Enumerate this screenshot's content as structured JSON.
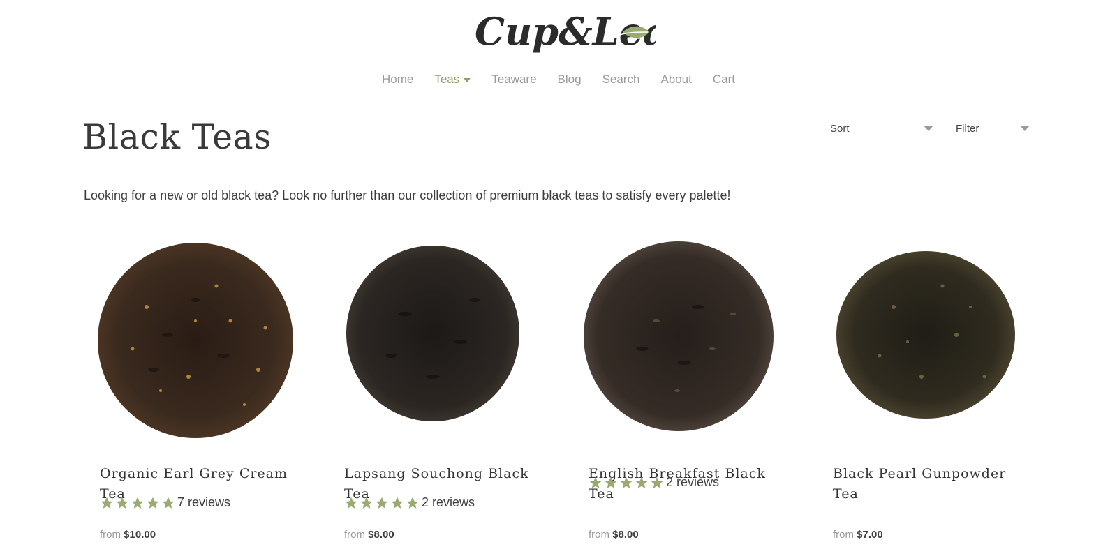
{
  "brand": {
    "logo_text": "Cup&Leaf"
  },
  "nav": [
    {
      "label": "Home",
      "active": false
    },
    {
      "label": "Teas",
      "active": true,
      "dropdown": true
    },
    {
      "label": "Teaware",
      "active": false
    },
    {
      "label": "Blog",
      "active": false
    },
    {
      "label": "Search",
      "active": false
    },
    {
      "label": "About",
      "active": false
    },
    {
      "label": "Cart",
      "active": false
    }
  ],
  "page": {
    "title": "Black Teas",
    "description": "Looking for a new or old black tea? Look no further than our collection of premium black teas to satisfy every palette!"
  },
  "controls": {
    "sort_label": "Sort",
    "filter_label": "Filter"
  },
  "colors": {
    "accent": "#8da063",
    "nav_text": "#9a9a9a",
    "star": "#9aab72"
  },
  "products": [
    {
      "name": "Organic Earl Grey Cream Tea",
      "stars": 5,
      "reviews": "7 reviews",
      "price_prefix": "from",
      "price": "$10.00",
      "icon": "loose-leaf-tea-image"
    },
    {
      "name": "Lapsang Souchong Black Tea",
      "stars": 5,
      "reviews": "2 reviews",
      "price_prefix": "from",
      "price": "$8.00",
      "icon": "loose-leaf-tea-image"
    },
    {
      "name": "English Breakfast Black Tea",
      "stars": 5,
      "reviews": "2 reviews",
      "price_prefix": "from",
      "price": "$8.00",
      "icon": "loose-leaf-tea-image"
    },
    {
      "name": "Black Pearl Gunpowder Tea",
      "stars": 0,
      "reviews": "",
      "price_prefix": "from",
      "price": "$7.00",
      "icon": "loose-leaf-tea-image"
    }
  ]
}
